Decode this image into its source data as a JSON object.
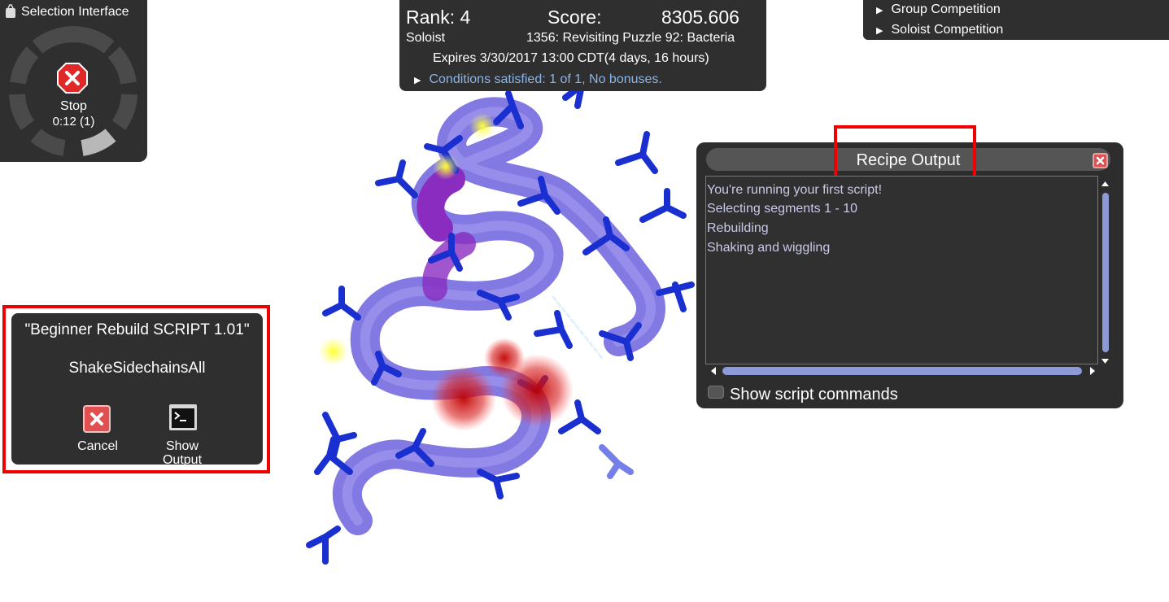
{
  "selection_panel": {
    "title": "Selection Interface",
    "stop_label": "Stop",
    "timer": "0:12 (1)"
  },
  "score_panel": {
    "rank": "Rank: 4",
    "score_label": "Score:",
    "score_value": "8305.606",
    "player_type": "Soloist",
    "puzzle_name": "1356: Revisiting Puzzle 92: Bacteria",
    "expires": "Expires 3/30/2017 13:00 CDT(4 days, 16 hours)",
    "conditions": "Conditions satisfied: 1 of 1, No bonuses."
  },
  "competition_panel": {
    "items": [
      "Group Competition",
      "Soloist Competition"
    ]
  },
  "recipe_dialog": {
    "name": "\"Beginner Rebuild SCRIPT 1.01\"",
    "current_step": "ShakeSidechainsAll",
    "cancel_label": "Cancel",
    "show_output_label_1": "Show",
    "show_output_label_2": "Output"
  },
  "recipe_output": {
    "title": "Recipe Output",
    "lines": [
      "You're running your first script!",
      "Selecting segments 1 - 10",
      "Rebuilding",
      "Shaking and wiggling"
    ],
    "show_commands_label": "Show script commands",
    "show_commands_checked": false
  },
  "colors": {
    "panel_bg": "#2f2f2f",
    "highlight_border": "#ee0000",
    "protein_backbone": "#7b72e0",
    "sidechain": "#1a2fd0",
    "clash": "#d01010",
    "link_blue": "#8ab4e8"
  }
}
